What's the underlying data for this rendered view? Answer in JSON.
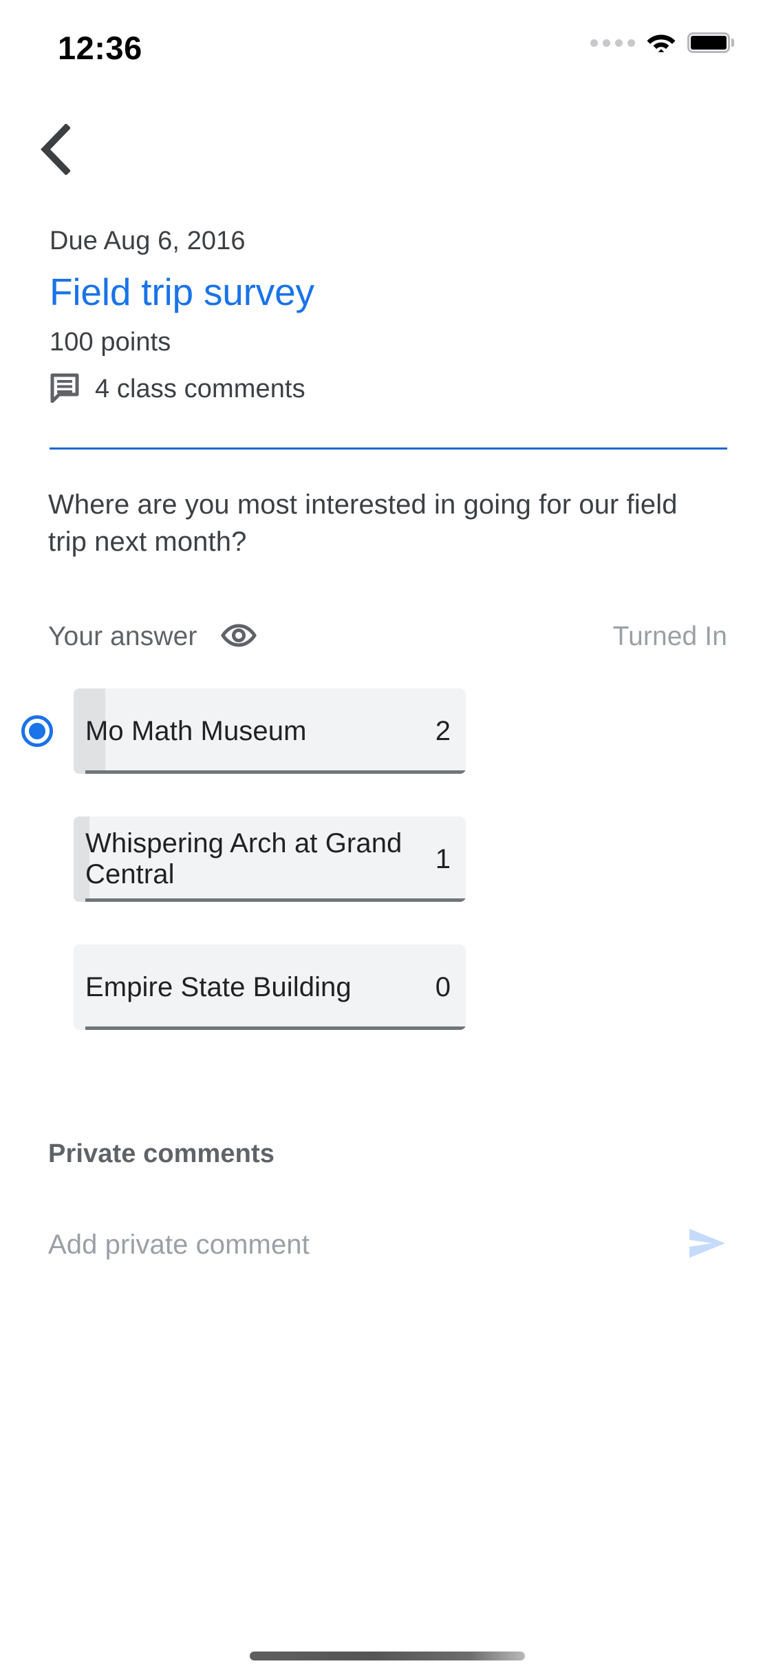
{
  "status_bar": {
    "time": "12:36",
    "signal_icon": "signal-dots-icon",
    "wifi_icon": "wifi-icon",
    "battery_icon": "battery-full-icon"
  },
  "nav": {
    "back_icon": "chevron-left-icon"
  },
  "assignment": {
    "due": "Due Aug 6, 2016",
    "title": "Field trip survey",
    "points": "100 points",
    "class_comments": "4 class comments",
    "comments_icon": "comment-bubble-icon"
  },
  "question": {
    "text": "Where are you most interested in going for our field trip next month?"
  },
  "answer_header": {
    "your_answer_label": "Your answer",
    "visibility_icon": "eye-icon",
    "status": "Turned In"
  },
  "chart_data": {
    "type": "bar",
    "title": "Where are you most interested in going for our field trip next month?",
    "categories": [
      "Mo Math Museum",
      "Whispering Arch at Grand Central",
      "Empire State Building"
    ],
    "values": [
      2,
      1,
      0
    ],
    "counts_display": [
      "2",
      "1",
      "0"
    ],
    "selected_index": 0,
    "xlabel": "",
    "ylabel": "",
    "ylim": [
      0,
      2
    ],
    "grid": false,
    "legend": "none",
    "orientation": "horizontal",
    "bar_track_color": "#f1f3f4",
    "bar_fill_color": "#dfe1e3",
    "baseline_color": "#70757a",
    "fill_percents": [
      8,
      4,
      0
    ]
  },
  "private_comments": {
    "heading": "Private comments",
    "input_placeholder": "Add private comment",
    "input_value": "",
    "send_icon": "send-icon"
  },
  "colors": {
    "accent_blue": "#1a73e8",
    "divider_blue": "#1967d2",
    "text_primary": "#202124",
    "text_secondary": "#3c4043",
    "text_muted": "#5f6368",
    "text_disabled": "#9aa0a6",
    "send_disabled": "#c6dafc"
  }
}
